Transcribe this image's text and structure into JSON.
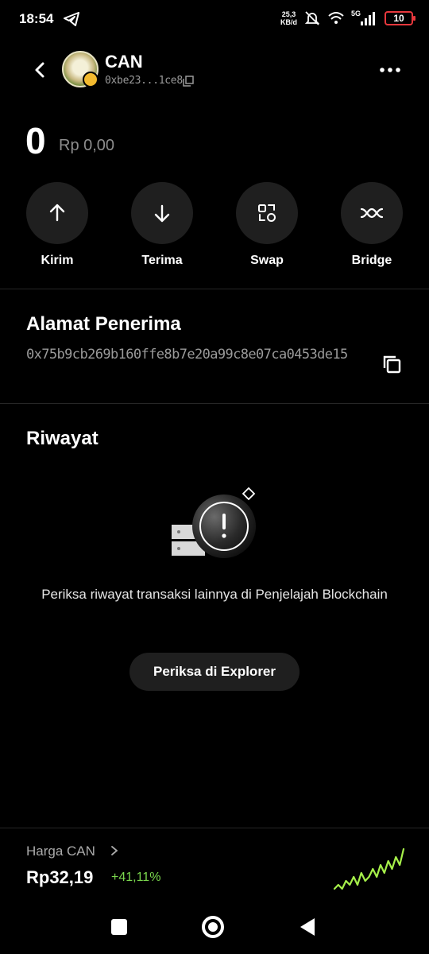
{
  "status_bar": {
    "time": "18:54",
    "speed_value": "25,3",
    "speed_unit": "KB/d",
    "network": "5G",
    "battery": "10"
  },
  "header": {
    "token_name": "CAN",
    "token_address": "0xbe23...1ce8"
  },
  "balance": {
    "amount": "0",
    "fiat": "Rp 0,00"
  },
  "actions": [
    {
      "label": "Kirim",
      "icon": "arrow-up-icon"
    },
    {
      "label": "Terima",
      "icon": "arrow-down-icon"
    },
    {
      "label": "Swap",
      "icon": "swap-icon"
    },
    {
      "label": "Bridge",
      "icon": "bridge-icon"
    }
  ],
  "recipient": {
    "title": "Alamat Penerima",
    "address": "0x75b9cb269b160ffe8b7e20a99c8e07ca0453de15"
  },
  "history": {
    "title": "Riwayat",
    "empty_text": "Periksa riwayat transaksi lainnya di Penjelajah Blockchain",
    "explorer_button": "Periksa di Explorer"
  },
  "price": {
    "label": "Harga CAN",
    "value": "Rp32,19",
    "change": "+41,11%",
    "change_color": "#7bd84e",
    "sparkline": [
      2,
      3,
      2,
      4,
      3,
      5,
      3,
      6,
      4,
      5,
      7,
      5,
      8,
      6,
      9,
      7,
      10,
      8,
      12
    ]
  }
}
